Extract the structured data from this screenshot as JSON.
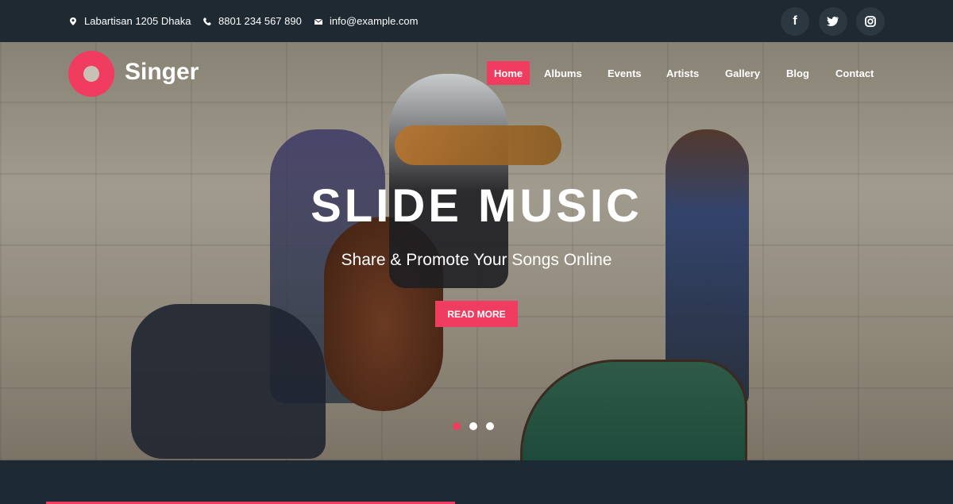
{
  "topbar": {
    "address": "Labartisan 1205 Dhaka",
    "phone": "8801 234 567 890",
    "email": "info@example.com",
    "social": [
      "facebook-icon",
      "twitter-icon",
      "instagram-icon"
    ]
  },
  "brand": {
    "name": "Singer"
  },
  "nav": {
    "items": [
      "Home",
      "Albums",
      "Events",
      "Artists",
      "Gallery",
      "Blog",
      "Contact"
    ],
    "active": "Home"
  },
  "hero": {
    "title": "SLIDE MUSIC",
    "subtitle": "Share & Promote Your Songs Online",
    "cta": "READ MORE",
    "slides": 3,
    "active_slide": 1
  },
  "colors": {
    "accent": "#f03c5f",
    "dark": "#1e2931"
  }
}
